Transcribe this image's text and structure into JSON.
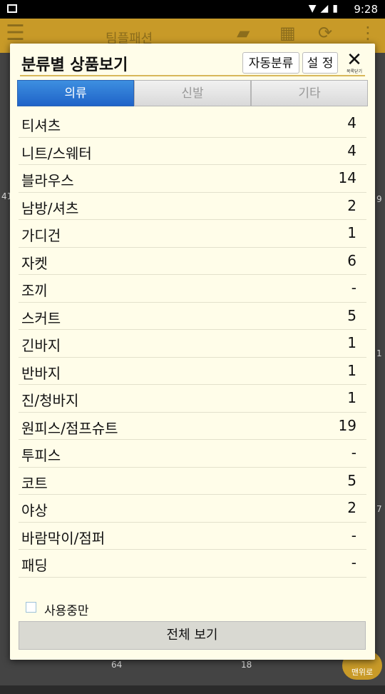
{
  "status_bar": {
    "time": "9:28"
  },
  "app_bar": {
    "title": "팀플패션"
  },
  "background": {
    "counts": [
      "41",
      "64",
      "18",
      "9",
      "7",
      "1"
    ],
    "badge_text": "맨위로"
  },
  "dialog": {
    "title": "분류별 상품보기",
    "auto_classify_label": "자동분류",
    "settings_label": "설 정",
    "close_caption": "목록닫기",
    "tabs": [
      {
        "label": "의류",
        "active": true
      },
      {
        "label": "신발",
        "active": false
      },
      {
        "label": "기타",
        "active": false
      }
    ],
    "items": [
      {
        "name": "티셔츠",
        "count": "4"
      },
      {
        "name": "니트/스웨터",
        "count": "4"
      },
      {
        "name": "블라우스",
        "count": "14"
      },
      {
        "name": "남방/셔츠",
        "count": "2"
      },
      {
        "name": "가디건",
        "count": "1"
      },
      {
        "name": "자켓",
        "count": "6"
      },
      {
        "name": "조끼",
        "count": "-"
      },
      {
        "name": "스커트",
        "count": "5"
      },
      {
        "name": "긴바지",
        "count": "1"
      },
      {
        "name": "반바지",
        "count": "1"
      },
      {
        "name": "진/청바지",
        "count": "1"
      },
      {
        "name": "원피스/점프슈트",
        "count": "19"
      },
      {
        "name": "투피스",
        "count": "-"
      },
      {
        "name": "코트",
        "count": "5"
      },
      {
        "name": "야상",
        "count": "2"
      },
      {
        "name": "바람막이/점퍼",
        "count": "-"
      },
      {
        "name": "패딩",
        "count": "-"
      }
    ],
    "in_use_only_label": "사용중만",
    "view_all_label": "전체 보기"
  }
}
